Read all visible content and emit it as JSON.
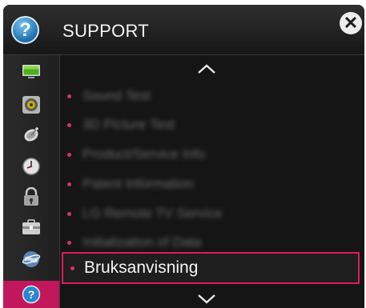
{
  "header": {
    "title": "SUPPORT",
    "icon": "help-icon"
  },
  "sidebar": {
    "items": [
      {
        "icon": "picture-icon"
      },
      {
        "icon": "sound-icon"
      },
      {
        "icon": "channel-dish-icon"
      },
      {
        "icon": "time-icon"
      },
      {
        "icon": "lock-icon"
      },
      {
        "icon": "option-icon"
      },
      {
        "icon": "network-icon"
      },
      {
        "icon": "support-icon",
        "selected": true
      }
    ]
  },
  "menu": {
    "items": [
      {
        "label": "Sound Test"
      },
      {
        "label": "3D Picture Test"
      },
      {
        "label": "Product/Service Info"
      },
      {
        "label": "Patent Information"
      },
      {
        "label": "LG Remote TV Service"
      },
      {
        "label": "Initialization of Data"
      },
      {
        "label": "Bruksanvisning",
        "selected": true
      }
    ]
  },
  "colors": {
    "accent": "#e01a5c",
    "selected_tab": "#c2185b"
  }
}
